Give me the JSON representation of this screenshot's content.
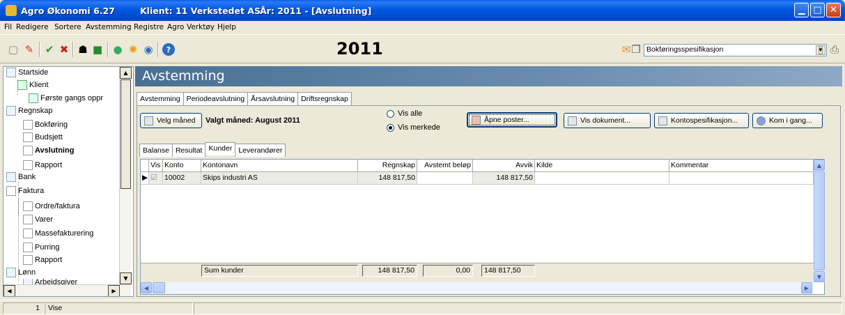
{
  "window": {
    "app_title": "Agro Økonomi 6.27",
    "client_title": "Klient:  11  Verkstedet AS",
    "year_title": "År: 2011 - [Avslutning]"
  },
  "menu": [
    "Fil",
    "Redigere",
    "Sortere",
    "Avstemming",
    "Registre",
    "Agro",
    "Verktøy",
    "Hjelp"
  ],
  "toolbar": {
    "year": "2011",
    "spec_select_value": "Bokføringsspesifikasjon"
  },
  "sidebar": {
    "items": [
      {
        "label": "Startside"
      },
      {
        "label": "Klient"
      },
      {
        "label": "Første gangs oppr"
      },
      {
        "label": "Regnskap"
      },
      {
        "label": "Bokføring"
      },
      {
        "label": "Budsjett"
      },
      {
        "label": "Avslutning"
      },
      {
        "label": "Rapport"
      },
      {
        "label": "Bank"
      },
      {
        "label": "Faktura"
      },
      {
        "label": "Ordre/faktura"
      },
      {
        "label": "Varer"
      },
      {
        "label": "Massefakturering"
      },
      {
        "label": "Purring"
      },
      {
        "label": "Rapport"
      },
      {
        "label": "Lønn"
      },
      {
        "label": "Arbeidsgiver"
      }
    ]
  },
  "main": {
    "header": "Avstemming",
    "tabs": [
      "Avstemming",
      "Periodeavslutning",
      "Årsavslutning",
      "Driftsregnskap"
    ],
    "select_month_button": "Velg måned",
    "selected_month": "Valgt måned: August 2011",
    "radio_all": "Vis alle",
    "radio_marked": "Vis merkede",
    "buttons": {
      "open_items": "Åpne poster...",
      "show_document": "Vis dokument...",
      "account_spec": "Kontospesifikasjon...",
      "get_started": "Kom i gang..."
    },
    "subtabs": [
      "Balanse",
      "Resultat",
      "Kunder",
      "Leverandører"
    ],
    "grid": {
      "headers": [
        "Vis",
        "Konto",
        "Kontonavn",
        "Regnskap",
        "Avstemt beløp",
        "Avvik",
        "Kilde",
        "Kommentar"
      ],
      "rows": [
        {
          "vis": "☑",
          "konto": "10002",
          "kontonavn": "Skips industri AS",
          "regnskap": "148 817,50",
          "avstemt": "",
          "avvik": "148 817,50",
          "kilde": "",
          "kommentar": ""
        }
      ],
      "sum_label": "Sum kunder",
      "sum_regnskap": "148 817,50",
      "sum_avstemt": "0,00",
      "sum_avvik": "148 817,50"
    }
  },
  "status": {
    "number": "1",
    "mode": "Vise"
  }
}
